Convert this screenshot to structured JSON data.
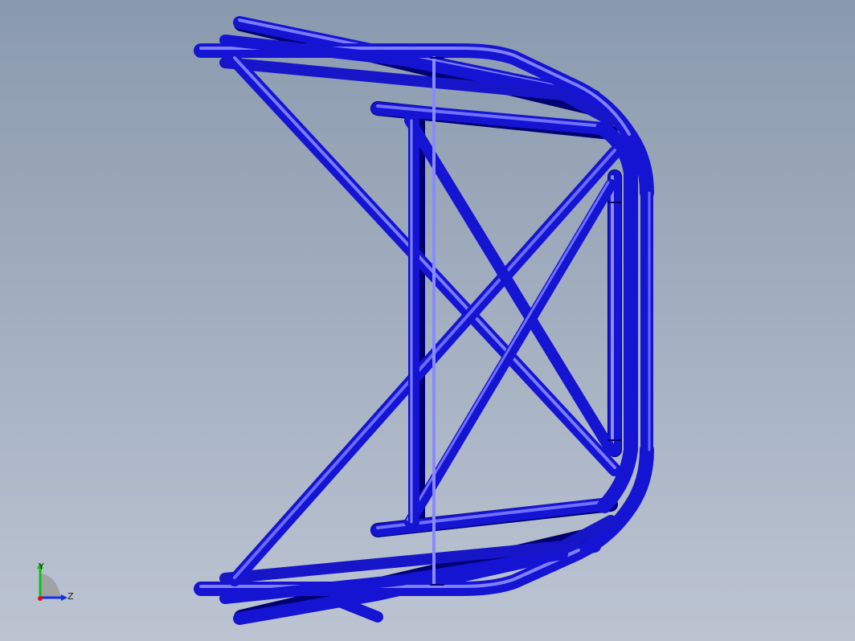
{
  "viewport": {
    "background_top": "#8a9aae",
    "background_bottom": "#bcc4d2",
    "model_color": "#1414d2",
    "model_highlight": "#6a6aff",
    "model_shadow": "#000070"
  },
  "triad": {
    "y_label": "Y",
    "z_label": "Z",
    "y_color": "#10c010",
    "z_color": "#1030e0",
    "x_color": "#e01010"
  }
}
